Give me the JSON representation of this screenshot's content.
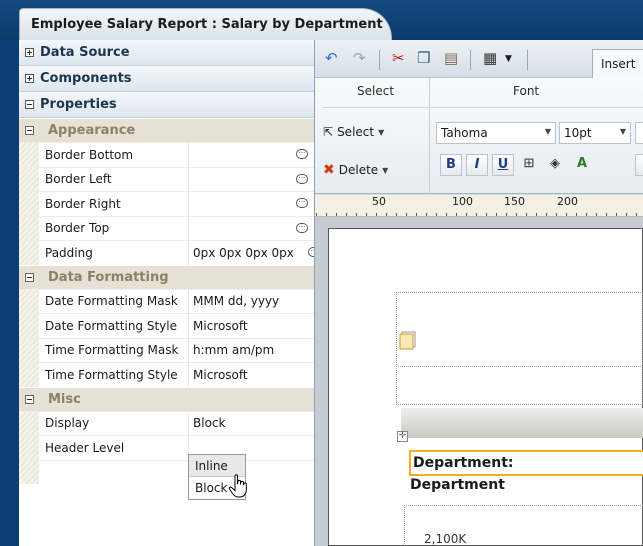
{
  "tab_title": "Employee Salary Report : Salary by Department",
  "accordion": {
    "data_source": "Data Source",
    "components": "Components",
    "properties": "Properties"
  },
  "sections": {
    "appearance": "Appearance",
    "data_formatting": "Data Formatting",
    "misc": "Misc"
  },
  "properties": {
    "border_bottom": {
      "name": "Border Bottom",
      "value": ""
    },
    "border_left": {
      "name": "Border Left",
      "value": ""
    },
    "border_right": {
      "name": "Border Right",
      "value": ""
    },
    "border_top": {
      "name": "Border Top",
      "value": ""
    },
    "padding": {
      "name": "Padding",
      "value": "0px 0px 0px 0px"
    },
    "date_mask": {
      "name": "Date Formatting Mask",
      "value": "MMM dd, yyyy"
    },
    "date_style": {
      "name": "Date Formatting Style",
      "value": "Microsoft"
    },
    "time_mask": {
      "name": "Time Formatting Mask",
      "value": "h:mm am/pm"
    },
    "time_style": {
      "name": "Time Formatting Style",
      "value": "Microsoft"
    },
    "display": {
      "name": "Display",
      "value": "Block"
    },
    "header_level": {
      "name": "Header Level",
      "value": ""
    }
  },
  "header_level_options": [
    "Inline",
    "Block"
  ],
  "toolbar": {
    "insert_tab": "Insert"
  },
  "ribbon": {
    "select_group": "Select",
    "font_group": "Font",
    "select_btn": "Select",
    "delete_btn": "Delete",
    "font_name": "Tahoma",
    "font_size": "10pt",
    "bold": "B",
    "italic": "I",
    "underline": "U"
  },
  "ruler": [
    "50",
    "100",
    "150",
    "200"
  ],
  "canvas": {
    "dept_label": "Department:",
    "dept_value": "Department",
    "axis_value": "2,100K"
  },
  "colors": {
    "accent_highlight": "#f0b020",
    "frame_blue": "#0b3f73"
  }
}
